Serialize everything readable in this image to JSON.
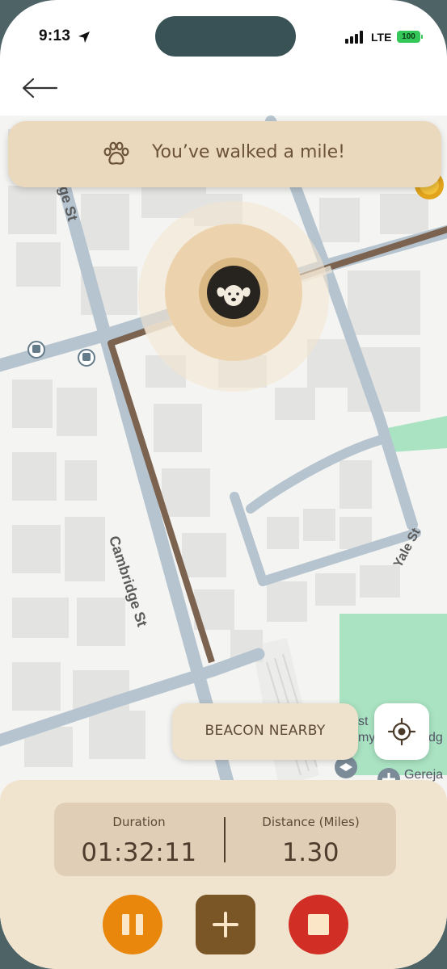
{
  "status_bar": {
    "time": "9:13",
    "network": "LTE",
    "battery": "100"
  },
  "header": {
    "back_icon": "arrow-left-icon"
  },
  "toast": {
    "icon": "paw-icon",
    "message": "You’ve walked a mile!"
  },
  "map": {
    "streets": [
      "Cambridge St",
      "Yale St"
    ],
    "clipped_labels": [
      "ge St",
      "st",
      "my",
      "dg",
      "Gereja"
    ],
    "pet_marker_icon": "dog-face-icon",
    "route_color": "#7b6350"
  },
  "beacon": {
    "label": "BEACON NEARBY",
    "locate_icon": "crosshair-icon"
  },
  "stats": {
    "duration_label": "Duration",
    "duration_value": "01:32:11",
    "distance_label": "Distance (Miles)",
    "distance_value": "1.30"
  },
  "controls": {
    "pause_icon": "pause-icon",
    "add_icon": "plus-icon",
    "stop_icon": "stop-icon"
  },
  "colors": {
    "accent_brown": "#7a5525",
    "pause_orange": "#e8870c",
    "stop_red": "#d12f25",
    "panel_beige": "#f1e4cf",
    "toast_beige": "#ebd9bd"
  }
}
